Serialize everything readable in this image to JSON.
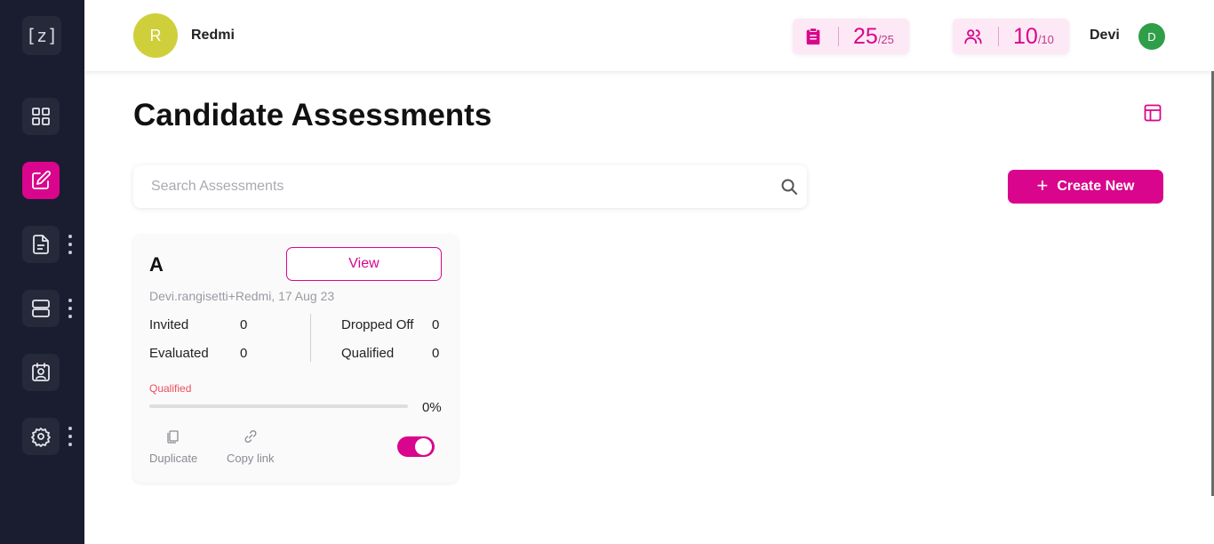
{
  "sidebar": {
    "logo": "[z]",
    "items": [
      {
        "icon": "dashboard-grid-icon",
        "active": false
      },
      {
        "icon": "edit-icon",
        "active": true
      },
      {
        "icon": "document-icon",
        "active": false
      },
      {
        "icon": "server-icon",
        "active": false
      },
      {
        "icon": "user-badge-icon",
        "active": false
      },
      {
        "icon": "settings-tools-icon",
        "active": false
      }
    ]
  },
  "header": {
    "org_initial": "R",
    "org_name": "Redmi",
    "assessments_quota": {
      "icon": "clipboard-icon",
      "used": "25",
      "total": "/25"
    },
    "users_quota": {
      "icon": "users-icon",
      "used": "10",
      "total": "/10"
    },
    "user_name": "Devi",
    "user_initial": "D"
  },
  "page": {
    "title": "Candidate Assessments",
    "layout_toggle_icon": "layout-icon"
  },
  "search": {
    "placeholder": "Search Assessments",
    "value": ""
  },
  "create_button": {
    "plus": "+",
    "label": "Create New"
  },
  "cards": [
    {
      "title": "A",
      "view_label": "View",
      "meta": "Devi.rangisetti+Redmi, 17 Aug 23",
      "stats": {
        "invited_label": "Invited",
        "invited": "0",
        "evaluated_label": "Evaluated",
        "evaluated": "0",
        "dropped_label": "Dropped Off",
        "dropped": "0",
        "qualified_label": "Qualified",
        "qualified": "0"
      },
      "progress_label": "Qualified",
      "progress_percent": 0,
      "progress_text": "0%",
      "duplicate_label": "Duplicate",
      "copy_link_label": "Copy link",
      "enabled": true
    }
  ],
  "colors": {
    "accent": "#d9058c",
    "sidebar_bg": "#1a1c30",
    "org_avatar": "#cfcf3c",
    "user_avatar": "#2f9e48",
    "progress_label": "#e84e5f"
  }
}
